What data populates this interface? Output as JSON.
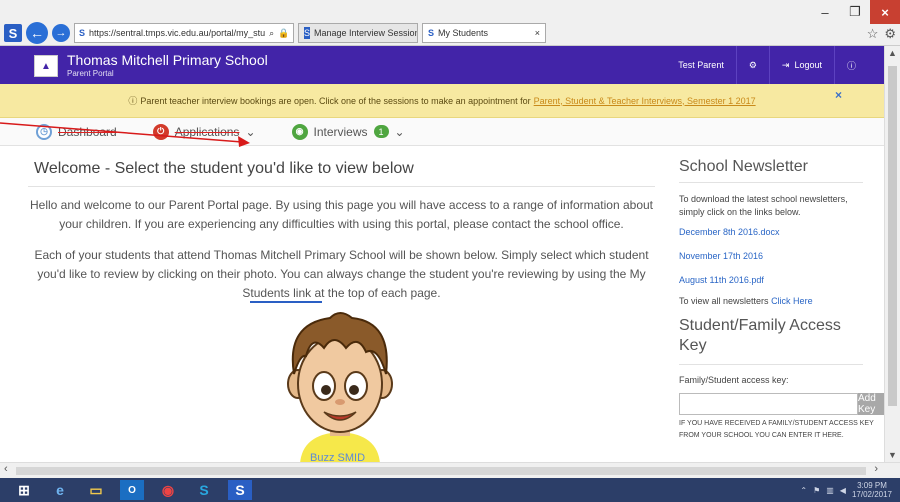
{
  "browser": {
    "url": "https://sentral.tmps.vic.edu.au/portal/my_stu",
    "tabs": [
      {
        "label": "Manage Interview Sessions - In..."
      },
      {
        "label": "My Students"
      }
    ],
    "tab_close": "×",
    "window_controls": {
      "minimize": "–",
      "restore": "❐",
      "close": "×"
    }
  },
  "header": {
    "school_name": "Thomas Mitchell Primary School",
    "subtitle": "Parent Portal",
    "user": "Test Parent",
    "logout": "Logout"
  },
  "alert": {
    "message": "Parent teacher interview bookings are open. Click one of the sessions to make an appointment for",
    "link": "Parent, Student & Teacher Interviews, Semester 1 2017",
    "close": "×"
  },
  "nav": {
    "dashboard": "Dashboard",
    "applications": "Applications",
    "interviews": "Interviews",
    "interviews_count": "1"
  },
  "main": {
    "title": "Welcome - Select the student you'd like to view below",
    "intro_1": "Hello and welcome to our Parent Portal page. By using this page you will have access to a range of information about your children. If you are experiencing any difficulties with using this portal, please contact the school office.",
    "intro_2a": "Each of your students that attend Thomas Mitchell Primary School will be shown below. Simply select which student you'd like to review by clicking on their photo. You can always change the student you're reviewing by using the",
    "intro_2_link": "My Students",
    "intro_2b": "link at the top of each page.",
    "student_name": "Buzz SMID"
  },
  "sidebar": {
    "newsletter_title": "School Newsletter",
    "newsletter_text": "To download the latest school newsletters, simply click on the links below.",
    "links": [
      "December 8th 2016.docx",
      "November 17th 2016",
      "August 11th 2016.pdf"
    ],
    "view_all_text": "To view all newsletters",
    "view_all_link": "Click Here",
    "key_title": "Student/Family Access Key",
    "key_label": "Family/Student access key:",
    "key_button": "Add Key",
    "key_note": "IF YOU HAVE RECEIVED A FAMILY/STUDENT ACCESS KEY FROM YOUR SCHOOL YOU CAN ENTER IT HERE."
  },
  "taskbar": {
    "time": "3:09 PM",
    "date": "17/02/2017"
  },
  "colors": {
    "header_bg": "#4224a8",
    "alert_bg": "#f7e9a1",
    "link": "#2a66c6",
    "taskbar": "#2c3e68"
  }
}
